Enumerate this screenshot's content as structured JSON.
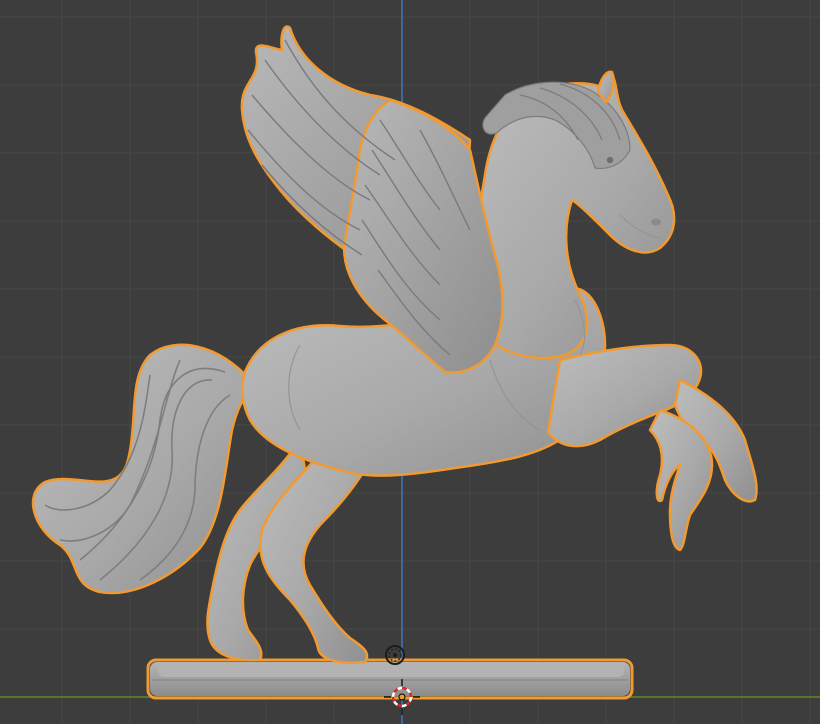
{
  "viewport": {
    "view": "front-orthographic",
    "background_color": "#3d3d3d",
    "grid_color": "#484848",
    "axis_x_color": "#5f8a2c",
    "axis_z_color": "#3e74c0",
    "selection_outline_color": "#f29a32",
    "model_color": "#a9a9a9"
  },
  "scene": {
    "object": {
      "type": "mesh",
      "subject": "pegasus-statue",
      "selected": true,
      "active": true
    },
    "cursor": {
      "icon": "3d-cursor-icon"
    },
    "origin": {
      "icon": "object-origin-icon"
    },
    "light": {
      "icon": "light-icon"
    }
  }
}
